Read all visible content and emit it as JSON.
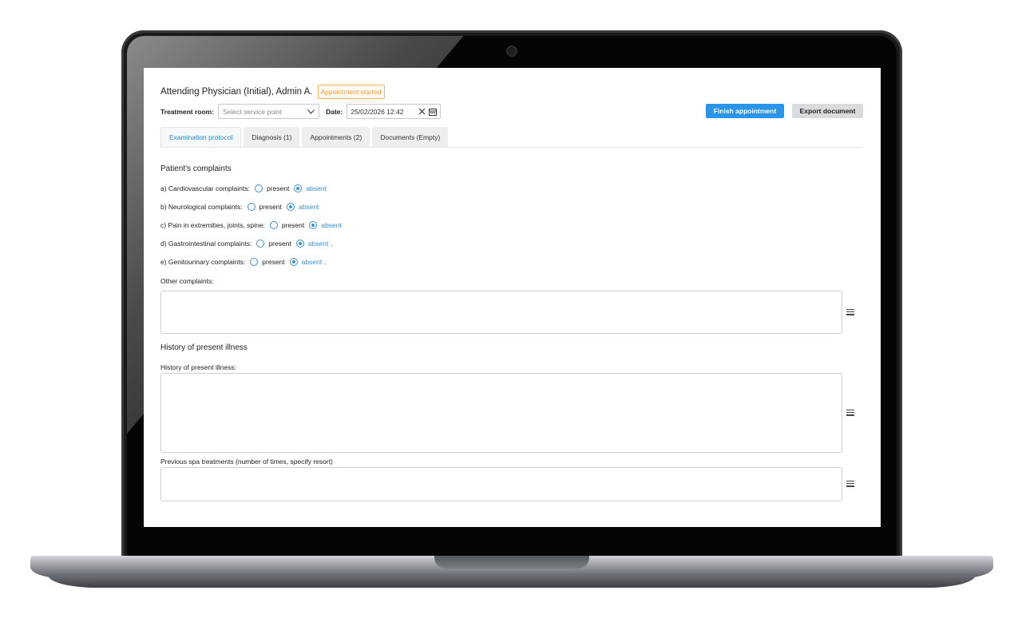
{
  "header": {
    "physician": "Attending Physician (Initial), Admin A.",
    "status": "Appointment started"
  },
  "toolbar": {
    "room_label": "Treatment room:",
    "room_placeholder": "Select service point",
    "date_label": "Date:",
    "date_value": "25/02/2026 12:42",
    "finish_label": "Finish appointment",
    "export_label": "Export document"
  },
  "tabs": [
    {
      "label": "Examination protocol"
    },
    {
      "label": "Diagnosis  (1)"
    },
    {
      "label": "Appointments  (2)"
    },
    {
      "label": "Documents  (Empty)"
    }
  ],
  "complaints": {
    "title": "Patient's complaints",
    "present_label": "present",
    "absent_label": "absent",
    "items": [
      {
        "label": "a) Cardiovascular complaints:",
        "value": "absent"
      },
      {
        "label": "b) Neurological complaints:",
        "value": "absent"
      },
      {
        "label": "c) Pain in extremities, joints, spine:",
        "value": "absent"
      },
      {
        "label": "d) Gastrointestinal complaints:",
        "value": "absent"
      },
      {
        "label": "e) Genitourinary complaints:",
        "value": "absent"
      }
    ],
    "trailing_dot": ".",
    "other_label": "Other complaints:"
  },
  "history": {
    "title": "History of present illness",
    "field_label": "History of present illness:",
    "spa_label": "Previous spa treatments (number of times, specify resort)"
  },
  "colors": {
    "accent": "#2a95e8",
    "badge": "#f0a040"
  }
}
